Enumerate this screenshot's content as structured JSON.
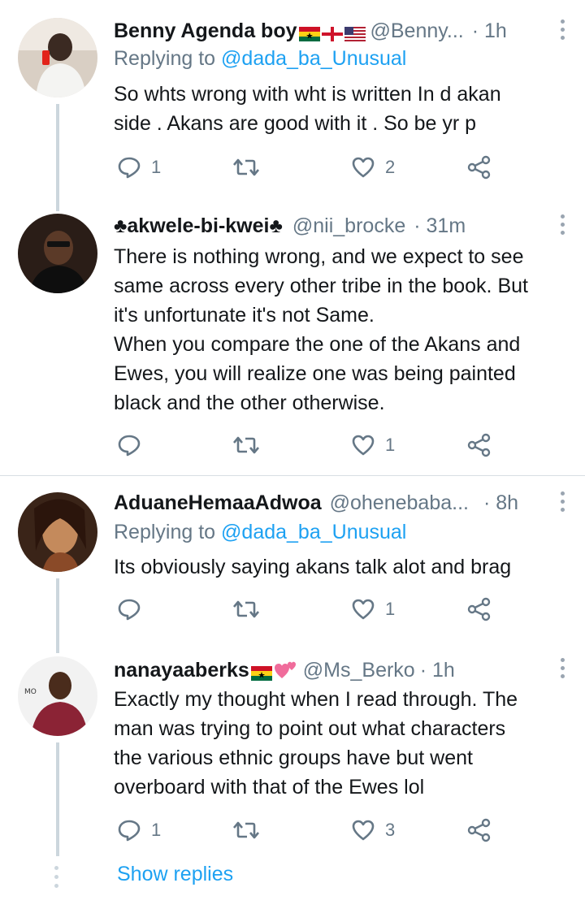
{
  "tweets": [
    {
      "name": "Benny Agenda boy",
      "flags": [
        "ghana-flag",
        "england-flag",
        "usa-flag"
      ],
      "handle": "@Benny...",
      "time": "· 1h",
      "replying_label": "Replying to",
      "replying_to": "@dada_ba_Unusual",
      "lines": [
        "So whts wrong with wht is written In d akan",
        "side . Akans are good with it . So be yr p"
      ],
      "replies": "1",
      "retweets": "",
      "likes": "2"
    },
    {
      "name_prefix": "♣",
      "name": "akwele-bi-kwei",
      "name_suffix": "♣",
      "handle": "@nii_brocke",
      "time": "· 31m",
      "lines": [
        "There is nothing wrong, and we expect to see",
        "same across every other tribe in the book. But",
        "it's unfortunate it's not Same.",
        "When you compare the one of the Akans and",
        "Ewes, you will realize one was being painted",
        "black and the other otherwise."
      ],
      "replies": "",
      "retweets": "",
      "likes": "1"
    },
    {
      "name": "AduaneHemaaAdwoa",
      "handle": "@ohenebaba...",
      "time": "· 8h",
      "replying_label": "Replying to",
      "replying_to": "@dada_ba_Unusual",
      "lines": [
        "Its obviously saying akans talk alot and brag"
      ],
      "replies": "",
      "retweets": "",
      "likes": "1"
    },
    {
      "name": "nanayaaberks",
      "flags": [
        "ghana-flag",
        "two-hearts"
      ],
      "handle": "@Ms_Berko",
      "time": "· 1h",
      "lines": [
        "Exactly my thought when I read through. The",
        "man was trying to point out what characters",
        "the various ethnic groups have but went",
        "overboard with that of the Ewes lol"
      ],
      "replies": "1",
      "retweets": "",
      "likes": "3"
    }
  ],
  "show_replies": "Show replies",
  "colors": {
    "link": "#1da1f2",
    "muted": "#657786",
    "thread_line": "#ccd6dd"
  }
}
